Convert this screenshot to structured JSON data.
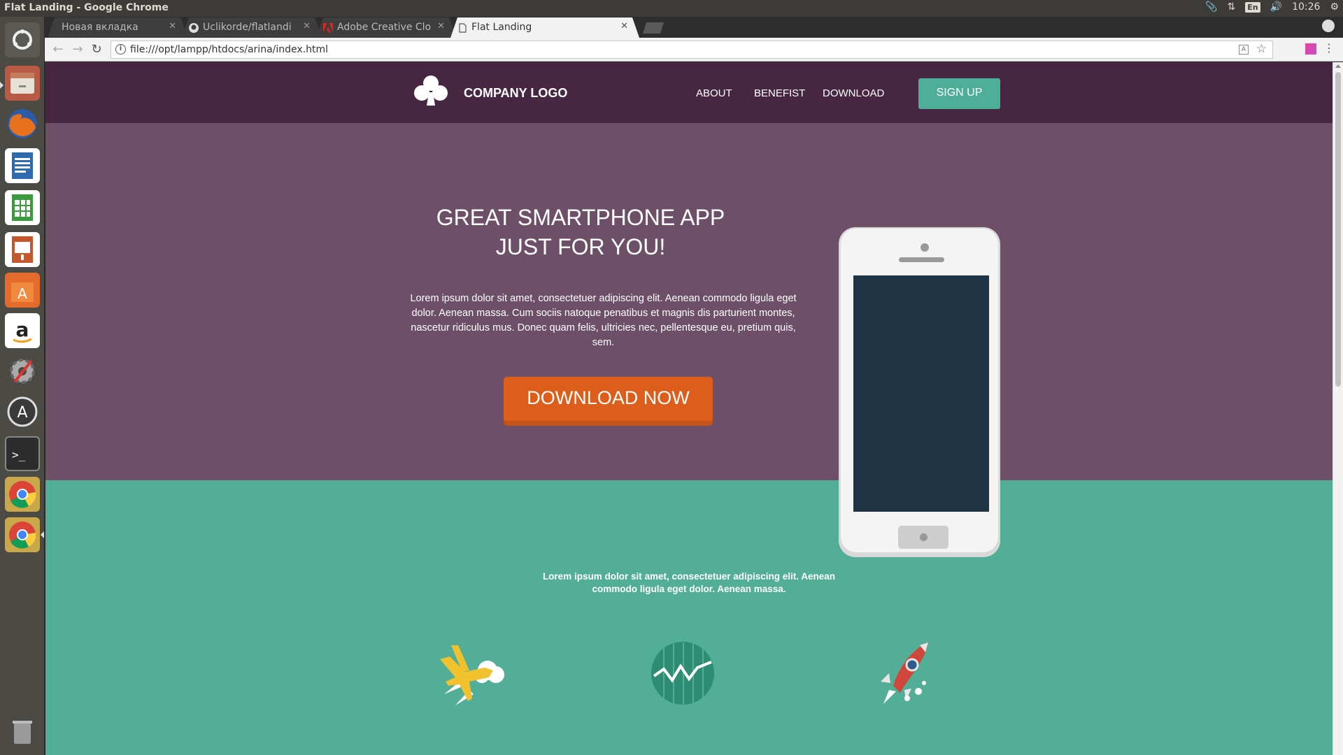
{
  "system": {
    "window_title": "Flat Landing - Google Chrome",
    "language": "En",
    "time": "10:26"
  },
  "browser": {
    "tabs": [
      {
        "label": "Новая вкладка",
        "active": false
      },
      {
        "label": "Uclikorde/flatlandi",
        "active": false
      },
      {
        "label": "Adobe Creative Clo",
        "active": false
      },
      {
        "label": "Flat Landing",
        "active": true
      }
    ],
    "url": "file:///opt/lampp/htdocs/arina/index.html"
  },
  "site": {
    "logo_text": "COMPANY LOGO",
    "nav": [
      "ABOUT",
      "BENEFIST",
      "DOWNLOAD"
    ],
    "signup_label": "SIGN UP",
    "hero_title_line1": "GREAT SMARTPHONE APP",
    "hero_title_line2": "JUST FOR YOU!",
    "hero_text": "Lorem ipsum dolor sit amet, consectetuer adipiscing elit. Aenean commodo ligula eget dolor. Aenean massa. Cum sociis natoque penatibus et magnis dis parturient montes, nascetur ridiculus mus. Donec quam felis, ultricies nec, pellentesque eu, pretium quis, sem.",
    "download_label": "DOWNLOAD NOW",
    "features_intro": "Lorem ipsum dolor sit amet, consectetuer adipiscing elit. Aenean commodo ligula eget dolor. Aenean massa.",
    "feature_icons": [
      "airplane-icon",
      "chart-icon",
      "rocket-icon"
    ]
  },
  "colors": {
    "header_bg": "#472641",
    "hero_bg": "#6d5068",
    "accent_teal": "#52ae97",
    "cta_orange": "#dd5d1a",
    "phone_screen": "#1f3444"
  }
}
